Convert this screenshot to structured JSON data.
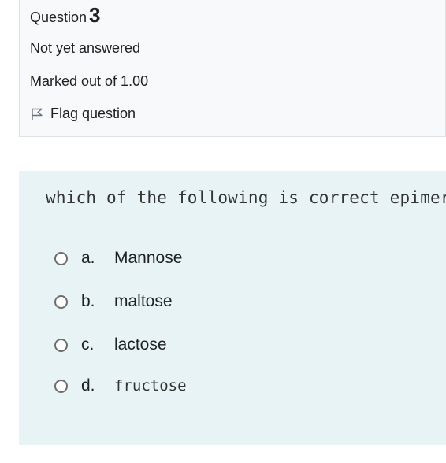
{
  "info": {
    "question_label": "Question",
    "question_number": "3",
    "state": "Not yet answered",
    "grade": "Marked out of 1.00",
    "flag_label": "Flag question"
  },
  "question": {
    "text": "which of the following is correct epimer"
  },
  "answers": [
    {
      "letter": "a.",
      "text": "Mannose"
    },
    {
      "letter": "b.",
      "text": "maltose"
    },
    {
      "letter": "c.",
      "text": "lactose"
    },
    {
      "letter": "d.",
      "text": "fructose"
    }
  ],
  "colors": {
    "info_background": "#f8f9fa",
    "content_background": "#e7f3f5",
    "text": "#1d2125"
  }
}
